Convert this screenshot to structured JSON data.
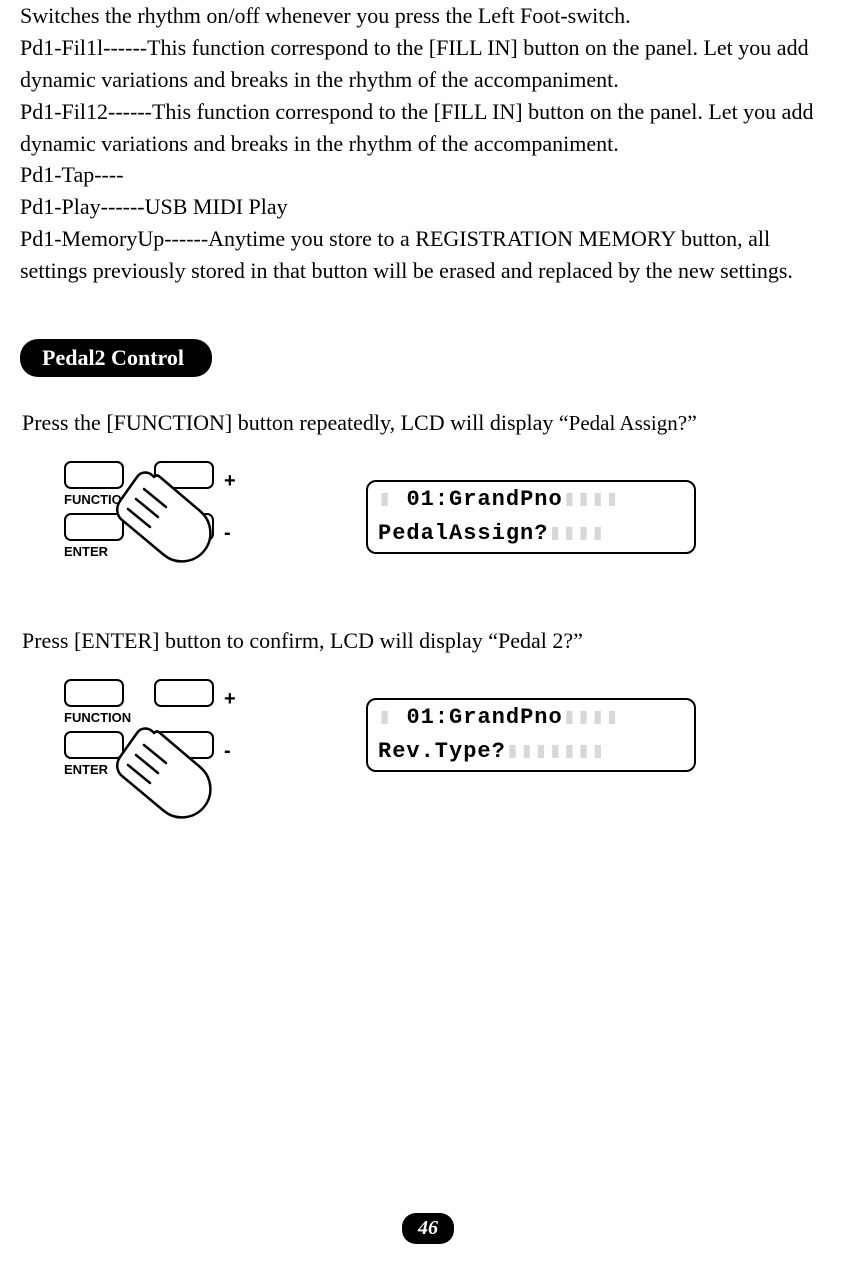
{
  "intro": {
    "p1": "Switches the rhythm on/off whenever you press the Left Foot-switch.",
    "p2": "Pd1-Fil1l------This function correspond to the [FILL IN] button on the panel. Let you add dynamic variations and breaks in the rhythm of the accompaniment.",
    "p3": "Pd1-Fil12------This function correspond to the [FILL IN] button on the panel. Let you add dynamic variations and breaks in the rhythm of the accompaniment.",
    "p4": "Pd1-Tap----",
    "p5": "Pd1-Play------USB MIDI Play",
    "p6": "Pd1-MemoryUp------Anytime you store to a REGISTRATION MEMORY button, all settings previously stored in that button will be erased and replaced by the new settings."
  },
  "heading": "Pedal2 Control",
  "step1": {
    "text_a": "Press the [FUNCTION] button repeatedly, LCD will display “",
    "text_b": "Pedal Assign?",
    "text_c": "”",
    "lcd_line1": " 01:GrandPno",
    "lcd_line2": "PedalAssign?",
    "labels": {
      "function": "FUNCTION",
      "plus": "+",
      "enter": "ENTER",
      "minus": "-"
    }
  },
  "step2": {
    "text": "Press [ENTER] button to confirm, LCD will display “Pedal 2?”",
    "lcd_line1": " 01:GrandPno",
    "lcd_line2": "Rev.Type?",
    "labels": {
      "function": "FUNCTION",
      "plus": "+",
      "enter": "ENTER",
      "minus": "-"
    }
  },
  "page_number": "46"
}
